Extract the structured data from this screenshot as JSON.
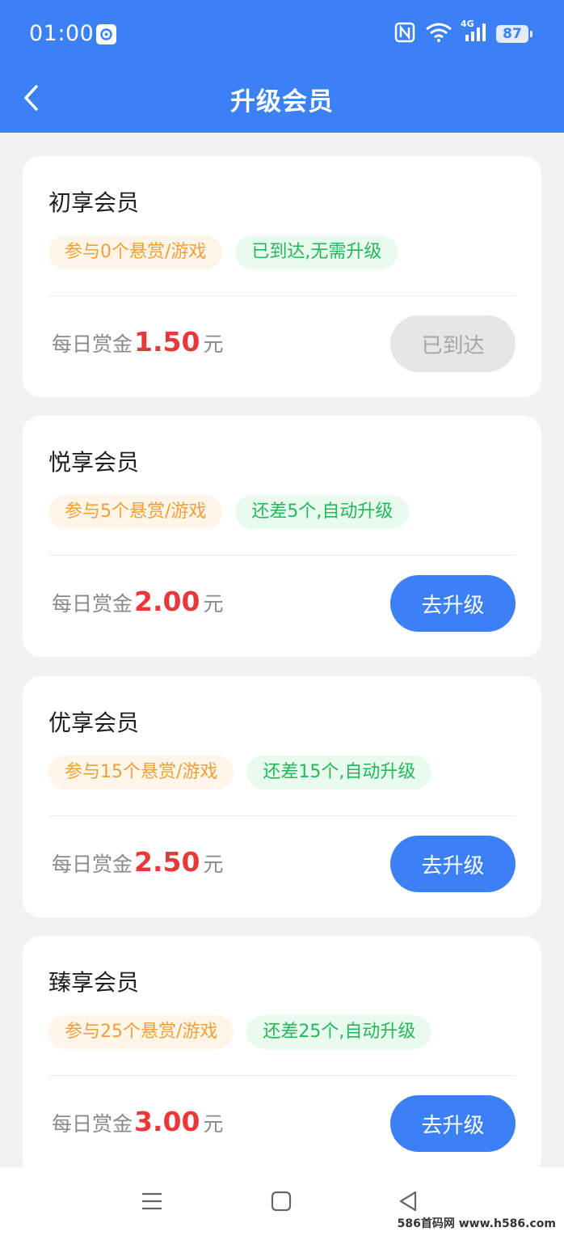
{
  "status_bar": {
    "time": "01:00",
    "battery": "87",
    "network": "4G",
    "icons": [
      "app-icon",
      "nfc-icon",
      "wifi-icon",
      "signal-icon",
      "battery-icon"
    ]
  },
  "header": {
    "title": "升级会员",
    "background": "#3c80f6"
  },
  "tiers": [
    {
      "name": "初享会员",
      "tag_requirement": "参与0个悬赏/游戏",
      "tag_status": "已到达,无需升级",
      "reward_label": "每日赏金",
      "reward_amount": "1.50",
      "reward_unit": "元",
      "button_label": "已到达",
      "button_state": "disabled"
    },
    {
      "name": "悦享会员",
      "tag_requirement": "参与5个悬赏/游戏",
      "tag_status": "还差5个,自动升级",
      "reward_label": "每日赏金",
      "reward_amount": "2.00",
      "reward_unit": "元",
      "button_label": "去升级",
      "button_state": "primary"
    },
    {
      "name": "优享会员",
      "tag_requirement": "参与15个悬赏/游戏",
      "tag_status": "还差15个,自动升级",
      "reward_label": "每日赏金",
      "reward_amount": "2.50",
      "reward_unit": "元",
      "button_label": "去升级",
      "button_state": "primary"
    },
    {
      "name": "臻享会员",
      "tag_requirement": "参与25个悬赏/游戏",
      "tag_status": "还差25个,自动升级",
      "reward_label": "每日赏金",
      "reward_amount": "3.00",
      "reward_unit": "元",
      "button_label": "去升级",
      "button_state": "primary"
    }
  ],
  "colors": {
    "primary": "#3c80f6",
    "reward": "#e8393a",
    "tag_orange_text": "#f0a03a",
    "tag_green_text": "#22b85a"
  },
  "nav_bar": {
    "icons": [
      "menu-icon",
      "home-square-icon",
      "back-triangle-icon"
    ]
  },
  "watermark": "586首码网 www.h586.com"
}
